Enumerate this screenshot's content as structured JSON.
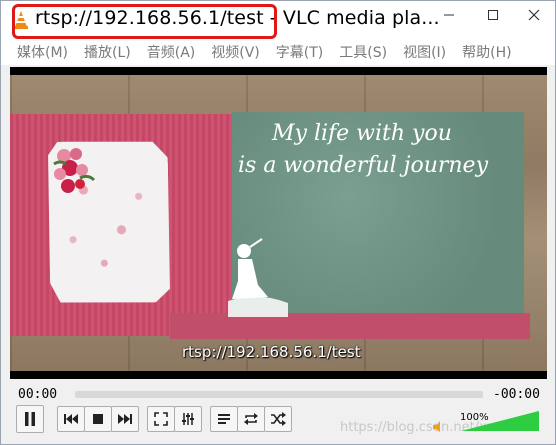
{
  "window": {
    "title": "rtsp://192.168.56.1/test - VLC media pla..."
  },
  "menu": {
    "items": [
      "媒体(M)",
      "播放(L)",
      "音频(A)",
      "视频(V)",
      "字幕(T)",
      "工具(S)",
      "视图(I)",
      "帮助(H)"
    ]
  },
  "video": {
    "overlay_line1": "My life with you",
    "overlay_line2": "is a wonderful journey",
    "stream_label": "rtsp://192.168.56.1/test"
  },
  "seek": {
    "elapsed": "00:00",
    "remaining": "-00:00"
  },
  "volume": {
    "percent": "100%",
    "level": 1.0
  },
  "watermark": "https://blog.csdn.net/xxxlllbbb",
  "colors": {
    "highlight": "#e01818",
    "volume_green": "#2ecc40"
  }
}
